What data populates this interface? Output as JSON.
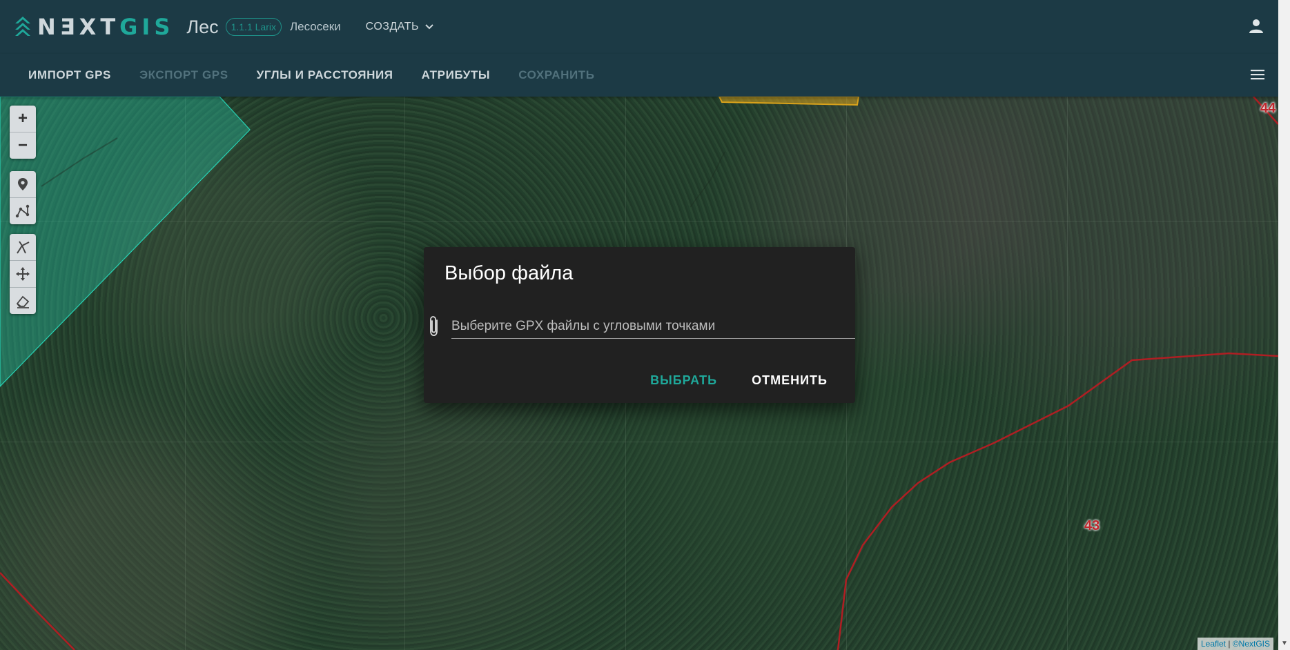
{
  "app": {
    "logo": {
      "part1": "NƎXT",
      "part2": "GIS"
    },
    "product": "Лес",
    "version": "1.1.1 Larix",
    "module": "Лесосеки",
    "create_label": "СОЗДАТЬ",
    "icons": {
      "user": "account-icon",
      "menu": "hamburger-menu-icon",
      "create": "chevron-down-icon"
    }
  },
  "nav": {
    "import_gps": "ИМПОРТ GPS",
    "export_gps": "ЭКСПОРТ GPS",
    "angles": "УГЛЫ И РАССТОЯНИЯ",
    "attributes": "АТРИБУТЫ",
    "save": "СОХРАНИТЬ"
  },
  "map": {
    "zoom_in": "+",
    "zoom_out": "−",
    "labels": {
      "parcel_44": "44",
      "parcel_43": "43"
    },
    "tools": [
      "marker-icon",
      "polyline-icon",
      "snap-icon",
      "move-icon",
      "eraser-icon"
    ],
    "colors": {
      "boundary": "#b01e23",
      "selection": "#27d3b5",
      "highlight": "#d9a21b"
    }
  },
  "dialog": {
    "title": "Выбор файла",
    "placeholder": "Выберите GPX файлы с угловыми точками",
    "select_label": "ВЫБРАТЬ",
    "cancel_label": "ОТМЕНИТЬ"
  },
  "attribution": {
    "leaflet": "Leaflet",
    "separator": " | ",
    "nextgis": "©NextGIS"
  },
  "colors": {
    "accent": "#1fa89a",
    "header": "#1c3a45",
    "dialog": "#212121"
  }
}
